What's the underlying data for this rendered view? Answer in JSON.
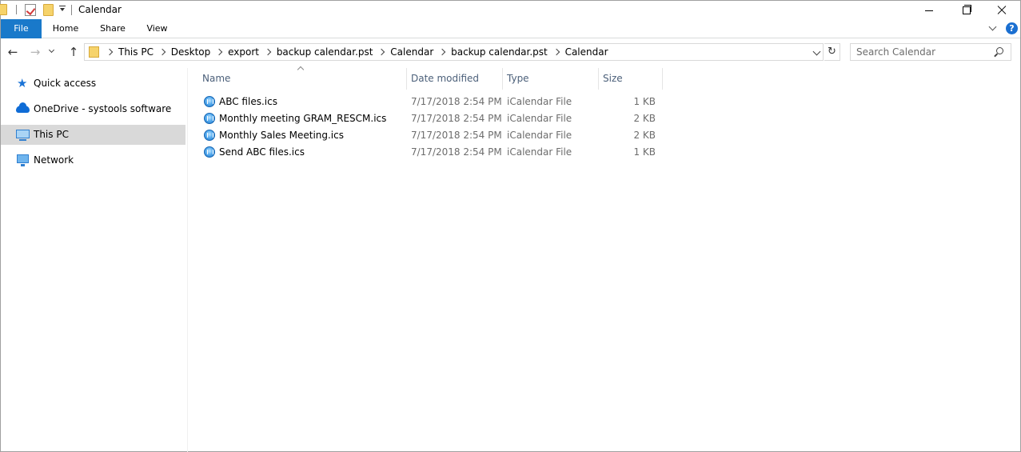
{
  "window": {
    "title": "Calendar"
  },
  "ribbon": {
    "tabs": [
      "File",
      "Home",
      "Share",
      "View"
    ],
    "help": "?"
  },
  "nav": {
    "breadcrumbs": [
      "This PC",
      "Desktop",
      "export",
      "backup calendar.pst",
      "Calendar",
      "backup calendar.pst",
      "Calendar"
    ],
    "search_placeholder": "Search Calendar"
  },
  "sidebar": {
    "items": [
      {
        "label": "Quick access",
        "icon": "star-icon",
        "selected": false
      },
      {
        "label": "OneDrive - systools software",
        "icon": "cloud-icon",
        "selected": false
      },
      {
        "label": "This PC",
        "icon": "computer-icon",
        "selected": true
      },
      {
        "label": "Network",
        "icon": "network-icon",
        "selected": false
      }
    ]
  },
  "files": {
    "columns": [
      "Name",
      "Date modified",
      "Type",
      "Size"
    ],
    "sort_column": "Name",
    "rows": [
      {
        "name": "ABC files.ics",
        "date": "7/17/2018 2:54 PM",
        "type": "iCalendar File",
        "size": "1 KB"
      },
      {
        "name": "Monthly meeting GRAM_RESCM.ics",
        "date": "7/17/2018 2:54 PM",
        "type": "iCalendar File",
        "size": "2 KB"
      },
      {
        "name": "Monthly Sales Meeting.ics",
        "date": "7/17/2018 2:54 PM",
        "type": "iCalendar File",
        "size": "2 KB"
      },
      {
        "name": "Send ABC files.ics",
        "date": "7/17/2018 2:54 PM",
        "type": "iCalendar File",
        "size": "1 KB"
      }
    ]
  },
  "colors": {
    "file_tab": "#1979ca",
    "selected_item": "#d9d9d9",
    "column_header_text": "#4c607a"
  }
}
